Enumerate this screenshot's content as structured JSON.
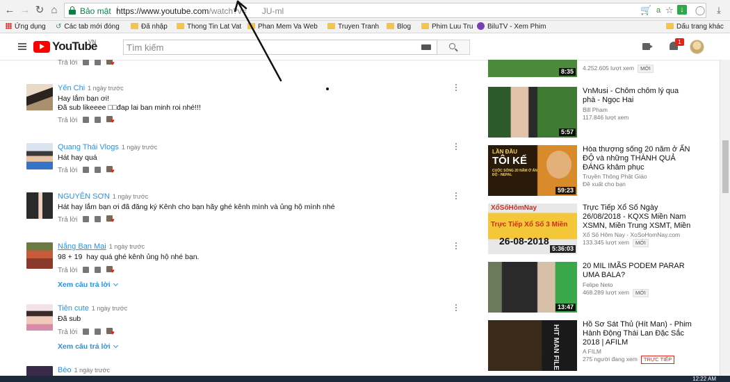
{
  "browser": {
    "secure_label": "Bảo mật",
    "url_main": "https://www.youtube.com",
    "url_path": "/watch?v=",
    "url_tail": "JU-ml"
  },
  "bookmarks": [
    {
      "label": "Ứng dụng",
      "kind": "apps"
    },
    {
      "label": "Các tab mới đóng",
      "kind": "history"
    },
    {
      "label": "Đã nhập",
      "kind": "folder"
    },
    {
      "label": "Thong Tin Lat Vat",
      "kind": "folder"
    },
    {
      "label": "Phan Mem Va Web",
      "kind": "folder"
    },
    {
      "label": "Truyen Tranh",
      "kind": "folder"
    },
    {
      "label": "Blog",
      "kind": "folder"
    },
    {
      "label": "Phim Luu Tru",
      "kind": "folder"
    },
    {
      "label": "BiluTV - Xem Phim",
      "kind": "site"
    },
    {
      "label": "Dấu trang khác",
      "kind": "folder"
    }
  ],
  "youtube": {
    "logo_text": "YouTube",
    "region": "VN",
    "search_placeholder": "Tìm kiếm",
    "notifications": "1"
  },
  "comments": [
    {
      "author": "",
      "time": "",
      "text": "",
      "reply_label": "Trả lời"
    },
    {
      "author": "Yến Chi",
      "time": "1 ngày trước",
      "text": "Hay lắm bạn ơi!\nĐã sub likeeee □□đap lai ban minh roi nhé!!!",
      "reply_label": "Trả lời"
    },
    {
      "author": "Quang Thái Vlogs",
      "time": "1 ngày trước",
      "text": "Hát hay quá",
      "reply_label": "Trả lời"
    },
    {
      "author": "NGUYÊN SƠN",
      "time": "1 ngày trước",
      "text": "Hát hay lắm bạn ơi đã đăng ký Kênh cho bạn hãy ghé kênh mình và ủng hộ mình nhé",
      "reply_label": "Trả lời"
    },
    {
      "author": "Nắng Ban Mai",
      "time": "1 ngày trước",
      "text": "98 + 19  hay quá ghé kênh ủng hộ nhé bạn.",
      "reply_label": "Trả lời",
      "more_replies": "Xem câu trả lời"
    },
    {
      "author": "Tiên cute",
      "time": "1 ngày trước",
      "text": "Đã sub",
      "reply_label": "Trả lời",
      "more_replies": "Xem câu trả lời"
    },
    {
      "author": "Bèo",
      "time": "1 ngày trước",
      "text": "",
      "reply_label": ""
    }
  ],
  "sidebar": [
    {
      "title": "",
      "channel": "",
      "views": "4.252.605 lượt xem",
      "badge": "MỚI",
      "duration": "8:35"
    },
    {
      "title": "VnMusi - Chôm chôm lý qua phà - Ngọc Hai",
      "channel": "Bill Pham",
      "views": "117.846 lượt xem",
      "badge": "",
      "duration": "5:57"
    },
    {
      "title": "Hòa thượng sống 20 năm ở ẤN ĐỘ và những THÀNH QUẢ ĐÁNG khâm phục",
      "channel": "Truyền Thông Phật Giáo",
      "views": "Đề xuất cho bạn",
      "badge": "",
      "duration": "59:23"
    },
    {
      "title": "Trực Tiếp Xổ Số Ngày 26/08/2018 - KQXS Miền Nam XSMN, Miền Trung XSMT, Miền",
      "channel": "Xổ Số Hôm Nay - XoSoHomNay.com",
      "views": "133.345 lượt xem",
      "badge": "MỚI",
      "duration": "5:36:03"
    },
    {
      "title": "20 MIL IMÃS PODEM PARAR UMA BALA?",
      "channel": "Felipe Neto",
      "views": "468.289 lượt xem",
      "badge": "MỚI",
      "duration": "13:47"
    },
    {
      "title": "Hồ Sơ Sát Thủ (Hít Man) - Phim Hành Động Thái Lan Đặc Sắc 2018 | AFILM",
      "channel": "A FILM",
      "views": "275 người đang xem",
      "badge_live": "TRỰC TIẾP",
      "duration": ""
    }
  ],
  "thumb_text": {
    "t3_top": "LẦN ĐẦU",
    "t3_big": "TÔI KỂ",
    "t3_small": "CUỘC SỐNG 20 NĂM Ở ẤN ĐỘ - NEPAL",
    "t4_brand": "XổSốHômNay",
    "t4_banner": "Trực Tiếp Xổ Số 3 Miền",
    "t4_date": "26-08-2018",
    "t6_text": "HIT MAN FILE"
  },
  "taskbar": {
    "clock": "12:22 AM"
  },
  "colors": {
    "accent": "#2793e6",
    "yt_red": "#ff0000",
    "secure": "#0b8043"
  }
}
